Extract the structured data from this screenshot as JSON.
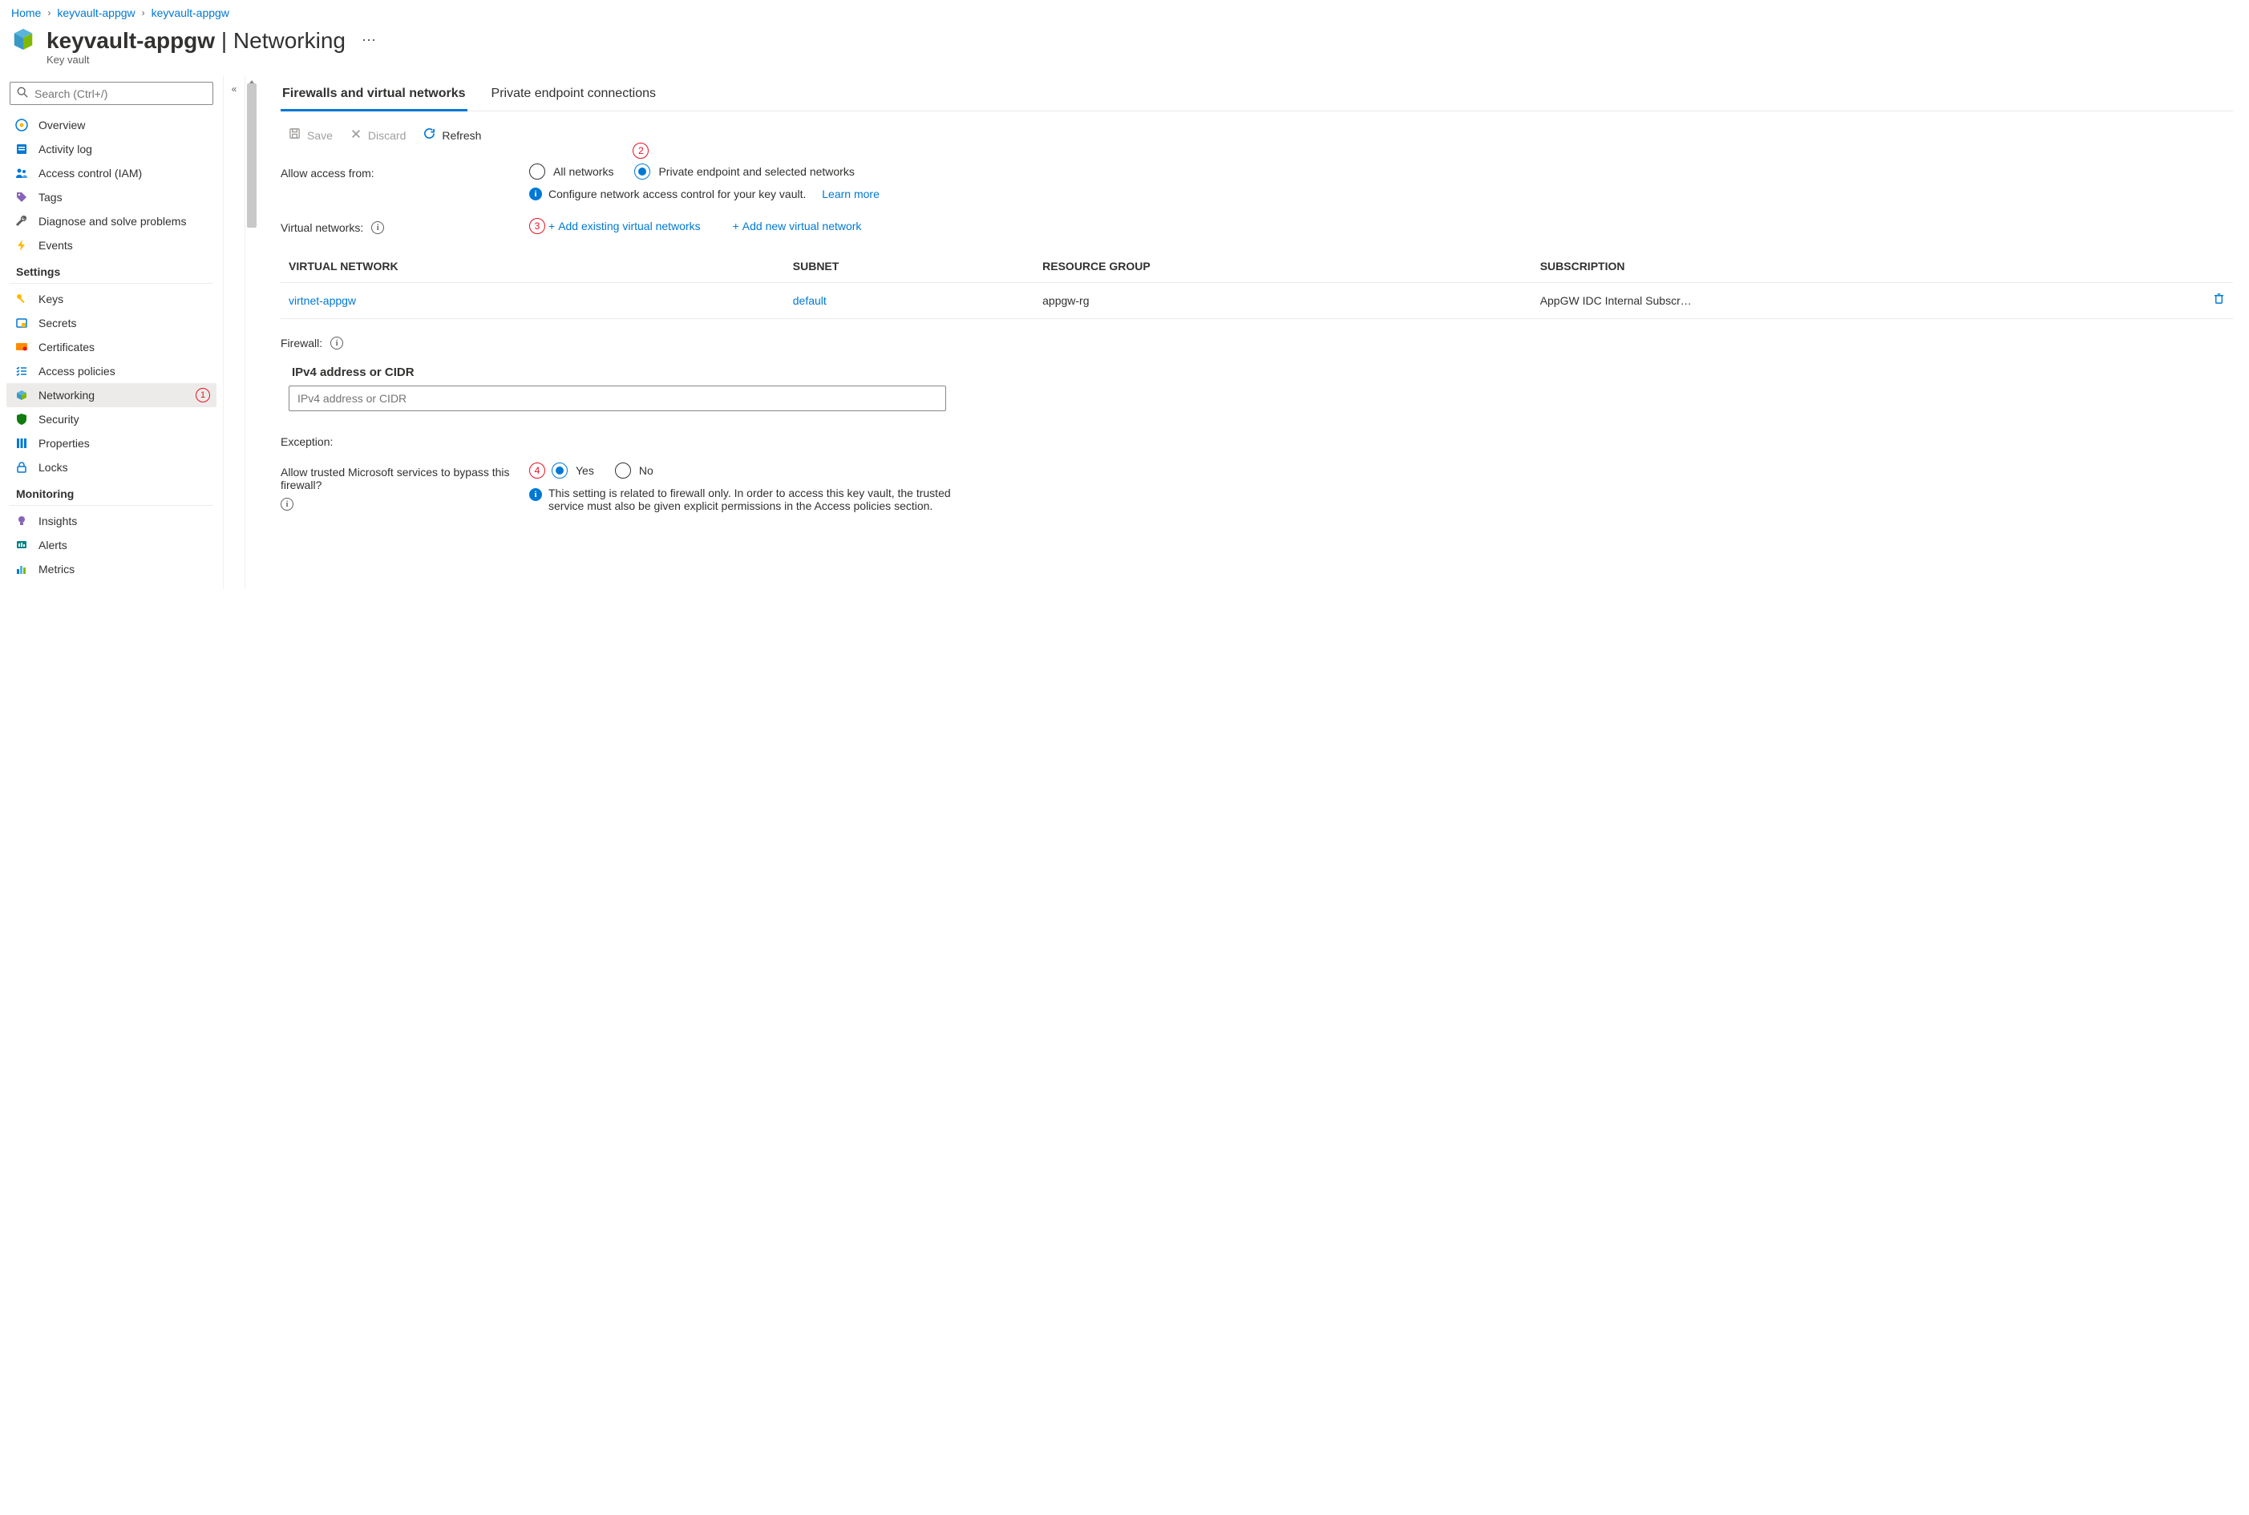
{
  "breadcrumb": {
    "home": "Home",
    "l1": "keyvault-appgw",
    "l2": "keyvault-appgw"
  },
  "header": {
    "title": "keyvault-appgw",
    "section": "Networking",
    "subtitle": "Key vault"
  },
  "search": {
    "placeholder": "Search (Ctrl+/)"
  },
  "nav": {
    "overview": "Overview",
    "activity": "Activity log",
    "iam": "Access control (IAM)",
    "tags": "Tags",
    "diagnose": "Diagnose and solve problems",
    "events": "Events",
    "group_settings": "Settings",
    "keys": "Keys",
    "secrets": "Secrets",
    "certs": "Certificates",
    "access_policies": "Access policies",
    "networking": "Networking",
    "security": "Security",
    "properties": "Properties",
    "locks": "Locks",
    "group_monitoring": "Monitoring",
    "insights": "Insights",
    "alerts": "Alerts",
    "metrics": "Metrics"
  },
  "tabs": {
    "t1": "Firewalls and virtual networks",
    "t2": "Private endpoint connections"
  },
  "toolbar": {
    "save": "Save",
    "discard": "Discard",
    "refresh": "Refresh"
  },
  "access": {
    "label": "Allow access from:",
    "opt_all": "All networks",
    "opt_private": "Private endpoint and selected networks",
    "info": "Configure network access control for your key vault.",
    "learn": "Learn more"
  },
  "vnet": {
    "label": "Virtual networks:",
    "add_existing": "Add existing virtual networks",
    "add_new": "Add new virtual network",
    "col_vnet": "VIRTUAL NETWORK",
    "col_subnet": "SUBNET",
    "col_rg": "RESOURCE GROUP",
    "col_sub": "SUBSCRIPTION",
    "rows": [
      {
        "vnet": "virtnet-appgw",
        "subnet": "default",
        "rg": "appgw-rg",
        "sub": "AppGW IDC Internal Subscr…"
      }
    ]
  },
  "firewall": {
    "label": "Firewall:",
    "header": "IPv4 address or CIDR",
    "placeholder": "IPv4 address or CIDR"
  },
  "exception": {
    "label": "Exception:",
    "question": "Allow trusted Microsoft services to bypass this firewall?",
    "yes": "Yes",
    "no": "No",
    "info": "This setting is related to firewall only. In order to access this key vault, the trusted service must also be given explicit permissions in the Access policies section."
  },
  "annot": {
    "a1": "1",
    "a2": "2",
    "a3": "3",
    "a4": "4"
  }
}
